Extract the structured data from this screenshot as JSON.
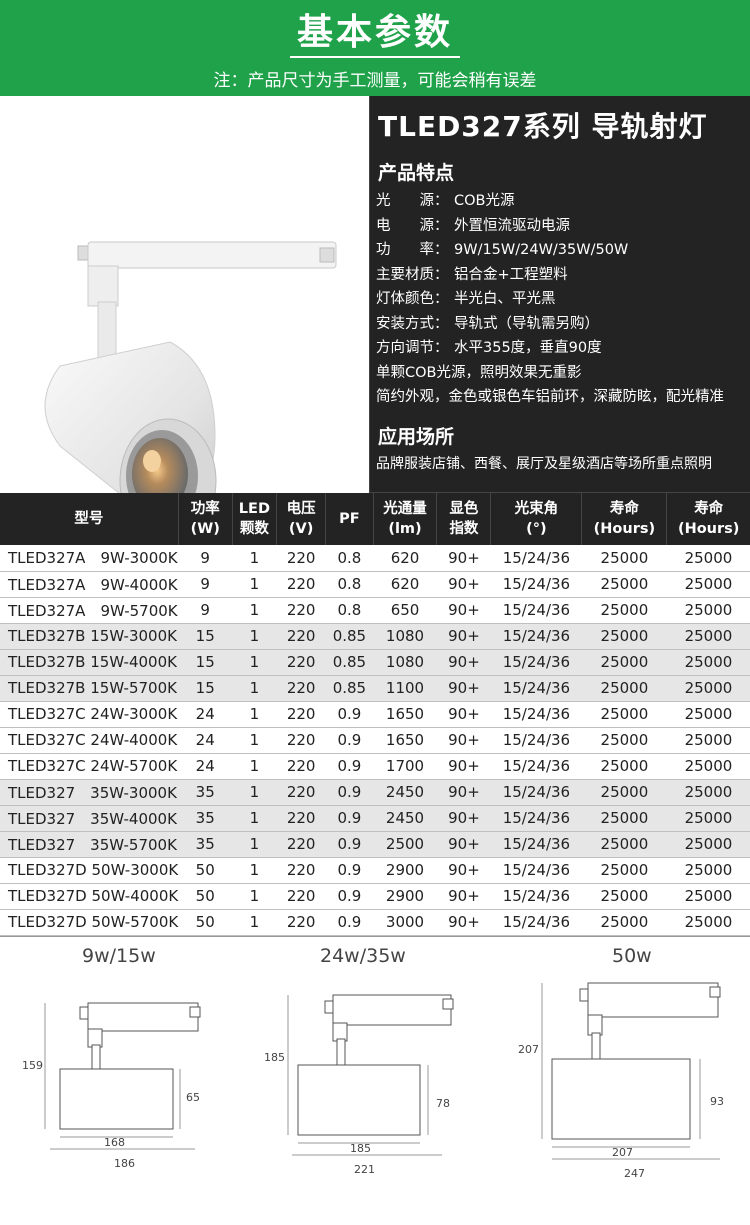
{
  "header": {
    "title": "基本参数",
    "note": "注：产品尺寸为手工测量，可能会稍有误差"
  },
  "product": {
    "name": "TLED327系列 导轨射灯",
    "features_title": "产品特点",
    "features": [
      {
        "k": "光　　源：",
        "v": "COB光源"
      },
      {
        "k": "电　　源：",
        "v": "外置恒流驱动电源"
      },
      {
        "k": "功　　率：",
        "v": "9W/15W/24W/35W/50W"
      },
      {
        "k": "主要材质：",
        "v": "铝合金+工程塑料"
      },
      {
        "k": "灯体颜色：",
        "v": "半光白、平光黑"
      },
      {
        "k": "安装方式：",
        "v": "导轨式（导轨需另购）"
      },
      {
        "k": "方向调节：",
        "v": "水平355度，垂直90度"
      }
    ],
    "extra1": "单颗COB光源，照明效果无重影",
    "extra2": "简约外观，金色或银色车铝前环，深藏防眩，配光精准",
    "app_title": "应用场所",
    "apps": "品牌服装店铺、西餐、展厅及星级酒店等场所重点照明"
  },
  "table": {
    "headers": [
      [
        "型号",
        ""
      ],
      [
        "功率",
        "(W)"
      ],
      [
        "LED",
        "颗数"
      ],
      [
        "电压",
        "(V)"
      ],
      [
        "PF",
        ""
      ],
      [
        "光通量",
        "(lm)"
      ],
      [
        "显色",
        "指数"
      ],
      [
        "光束角",
        "(°)"
      ],
      [
        "寿命",
        "(Hours)"
      ],
      [
        "寿命",
        "(Hours)"
      ]
    ],
    "rows": [
      [
        "TLED327A　9W-3000K",
        "9",
        "1",
        "220",
        "0.8",
        "620",
        "90+",
        "15/24/36",
        "25000",
        "25000"
      ],
      [
        "TLED327A　9W-4000K",
        "9",
        "1",
        "220",
        "0.8",
        "620",
        "90+",
        "15/24/36",
        "25000",
        "25000"
      ],
      [
        "TLED327A　9W-5700K",
        "9",
        "1",
        "220",
        "0.8",
        "650",
        "90+",
        "15/24/36",
        "25000",
        "25000"
      ],
      [
        "TLED327B 15W-3000K",
        "15",
        "1",
        "220",
        "0.85",
        "1080",
        "90+",
        "15/24/36",
        "25000",
        "25000"
      ],
      [
        "TLED327B 15W-4000K",
        "15",
        "1",
        "220",
        "0.85",
        "1080",
        "90+",
        "15/24/36",
        "25000",
        "25000"
      ],
      [
        "TLED327B 15W-5700K",
        "15",
        "1",
        "220",
        "0.85",
        "1100",
        "90+",
        "15/24/36",
        "25000",
        "25000"
      ],
      [
        "TLED327C 24W-3000K",
        "24",
        "1",
        "220",
        "0.9",
        "1650",
        "90+",
        "15/24/36",
        "25000",
        "25000"
      ],
      [
        "TLED327C 24W-4000K",
        "24",
        "1",
        "220",
        "0.9",
        "1650",
        "90+",
        "15/24/36",
        "25000",
        "25000"
      ],
      [
        "TLED327C 24W-5700K",
        "24",
        "1",
        "220",
        "0.9",
        "1700",
        "90+",
        "15/24/36",
        "25000",
        "25000"
      ],
      [
        "TLED327　35W-3000K",
        "35",
        "1",
        "220",
        "0.9",
        "2450",
        "90+",
        "15/24/36",
        "25000",
        "25000"
      ],
      [
        "TLED327　35W-4000K",
        "35",
        "1",
        "220",
        "0.9",
        "2450",
        "90+",
        "15/24/36",
        "25000",
        "25000"
      ],
      [
        "TLED327　35W-5700K",
        "35",
        "1",
        "220",
        "0.9",
        "2500",
        "90+",
        "15/24/36",
        "25000",
        "25000"
      ],
      [
        "TLED327D 50W-3000K",
        "50",
        "1",
        "220",
        "0.9",
        "2900",
        "90+",
        "15/24/36",
        "25000",
        "25000"
      ],
      [
        "TLED327D 50W-4000K",
        "50",
        "1",
        "220",
        "0.9",
        "2900",
        "90+",
        "15/24/36",
        "25000",
        "25000"
      ],
      [
        "TLED327D 50W-5700K",
        "50",
        "1",
        "220",
        "0.9",
        "3000",
        "90+",
        "15/24/36",
        "25000",
        "25000"
      ]
    ]
  },
  "dimensions": [
    {
      "title": "9w/15w",
      "height": "159",
      "body_h": "65",
      "body_w": "168",
      "total_w": "186"
    },
    {
      "title": "24w/35w",
      "height": "185",
      "body_h": "78",
      "body_w": "185",
      "total_w": "221"
    },
    {
      "title": "50w",
      "height": "207",
      "body_h": "93",
      "body_w": "207",
      "total_w": "247"
    }
  ]
}
